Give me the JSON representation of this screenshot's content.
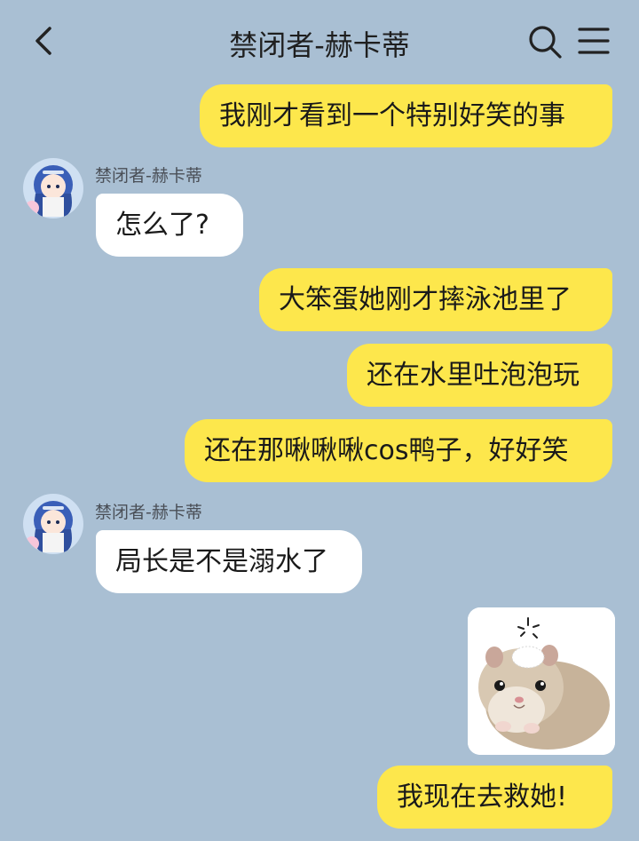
{
  "header": {
    "title": "禁闭者-赫卡蒂"
  },
  "messages": [
    {
      "side": "out",
      "text": "我刚才看到一个特别好笑的事"
    },
    {
      "side": "in",
      "sender": "禁闭者-赫卡蒂",
      "text": "怎么了?"
    },
    {
      "side": "out",
      "text": "大笨蛋她刚才摔泳池里了"
    },
    {
      "side": "out",
      "text": "还在水里吐泡泡玩"
    },
    {
      "side": "out",
      "text": "还在那啾啾啾cos鸭子，好好笑"
    },
    {
      "side": "in",
      "sender": "禁闭者-赫卡蒂",
      "text": "局长是不是溺水了"
    },
    {
      "side": "out",
      "type": "sticker",
      "sticker": "hamster-sticker"
    },
    {
      "side": "out",
      "text": "我现在去救她!"
    }
  ],
  "icons": {
    "back": "chevron-left-icon",
    "search": "search-icon",
    "menu": "menu-icon"
  },
  "colors": {
    "background": "#a9bfd3",
    "outgoing_bubble": "#fde74c",
    "incoming_bubble": "#ffffff"
  }
}
